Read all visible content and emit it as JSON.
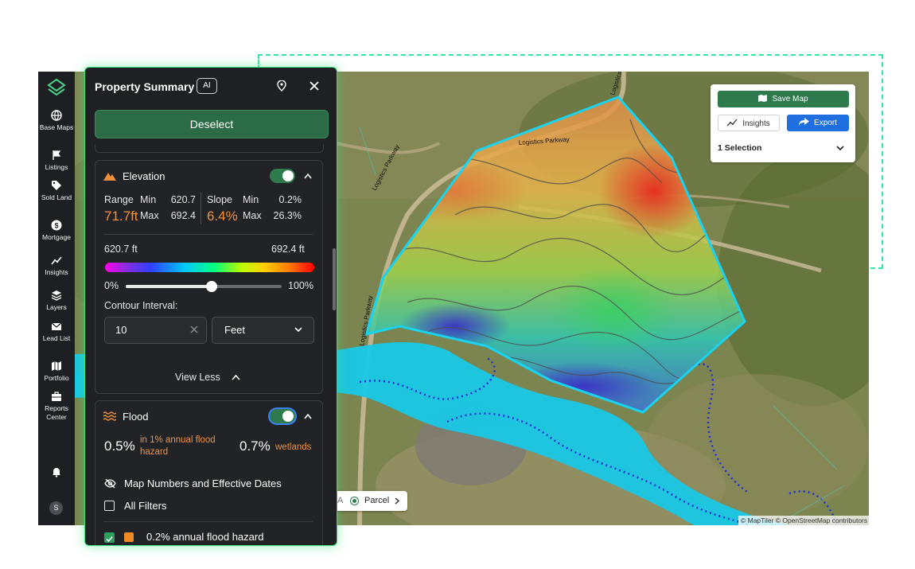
{
  "rail": {
    "items": [
      {
        "label": "Base Maps",
        "icon": "globe-icon"
      },
      {
        "label": "Listings",
        "icon": "flag-icon"
      },
      {
        "label": "Sold Land",
        "icon": "tag-icon"
      },
      {
        "label": "Mortgage",
        "icon": "dollar-icon"
      },
      {
        "label": "Insights",
        "icon": "insights-icon"
      },
      {
        "label": "Layers",
        "icon": "layers-icon"
      },
      {
        "label": "Lead List",
        "icon": "mail-icon"
      },
      {
        "label": "Portfolio",
        "icon": "map-icon"
      },
      {
        "label": "Reports Center",
        "icon": "briefcase-icon"
      }
    ],
    "avatar_initial": "S"
  },
  "panel": {
    "title": "Property Summary",
    "ai_badge": "AI",
    "deselect_label": "Deselect",
    "elevation": {
      "title": "Elevation",
      "enabled": true,
      "range_label": "Range",
      "range_value": "71.7ft",
      "range_min_label": "Min",
      "range_min": "620.7",
      "range_max_label": "Max",
      "range_max": "692.4",
      "slope_label": "Slope",
      "slope_value": "6.4%",
      "slope_min_label": "Min",
      "slope_min": "0.2%",
      "slope_max_label": "Max",
      "slope_max": "26.3%",
      "scale_min": "620.7 ft",
      "scale_max": "692.4 ft",
      "opacity_min_label": "0%",
      "opacity_max_label": "100%",
      "opacity_value": 0.55,
      "contour_label": "Contour Interval:",
      "contour_value": "10",
      "unit_value": "Feet",
      "view_less": "View Less"
    },
    "flood": {
      "title": "Flood",
      "enabled": true,
      "pct1": "0.5%",
      "note1": "in 1% annual flood hazard",
      "pct2": "0.7%",
      "note2": "wetlands",
      "map_numbers_label": "Map Numbers and Effective Dates",
      "all_filters_label": "All Filters",
      "partial_row_label": "0.2% annual flood hazard"
    }
  },
  "tools": {
    "save_map": "Save Map",
    "insights": "Insights",
    "export": "Export",
    "selection": "1 Selection"
  },
  "map": {
    "road_label_1": "Logistics Parkway",
    "road_label_2": "Logistics Parkway",
    "road_label_3": "Logistics Parkway",
    "road_label_4": "Logistics Parkway",
    "parcel_chip_prefix": "A",
    "parcel_chip_label": "Parcel",
    "attribution": "© MapTiler © OpenStreetMap contributors"
  },
  "colors": {
    "accent_green": "#2e7a4d",
    "glow_green": "#38e07a",
    "export_blue": "#1f6fe0",
    "orange": "#f0913a",
    "parcel_outline": "#19d3f0",
    "flood_fill": "#19c8e6"
  }
}
